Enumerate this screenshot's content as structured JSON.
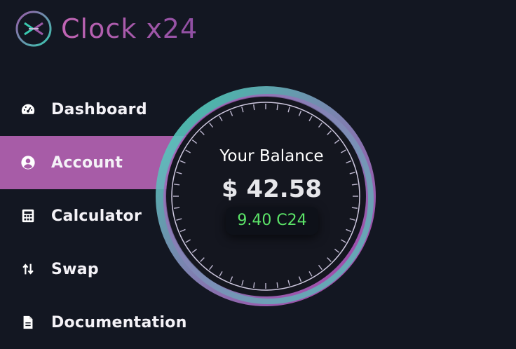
{
  "app": {
    "name": "Clock x24",
    "logo_icon": "x24-ring-logo",
    "brand_colors": {
      "accent": "#a75ca7",
      "teal": "#39c9b0",
      "magenta": "#c148b8",
      "background": "#131722",
      "token_green": "#5be368"
    }
  },
  "sidebar": {
    "items": [
      {
        "label": "Dashboard",
        "icon": "gauge-icon",
        "active": false
      },
      {
        "label": "Account",
        "icon": "user-circle-icon",
        "active": true
      },
      {
        "label": "Calculator",
        "icon": "calculator-icon",
        "active": false
      },
      {
        "label": "Swap",
        "icon": "swap-arrows-icon",
        "active": false
      },
      {
        "label": "Documentation",
        "icon": "document-icon",
        "active": false
      }
    ]
  },
  "balance": {
    "title": "Your Balance",
    "usd_value": "$ 42.58",
    "token_value": "9.40 C24"
  }
}
